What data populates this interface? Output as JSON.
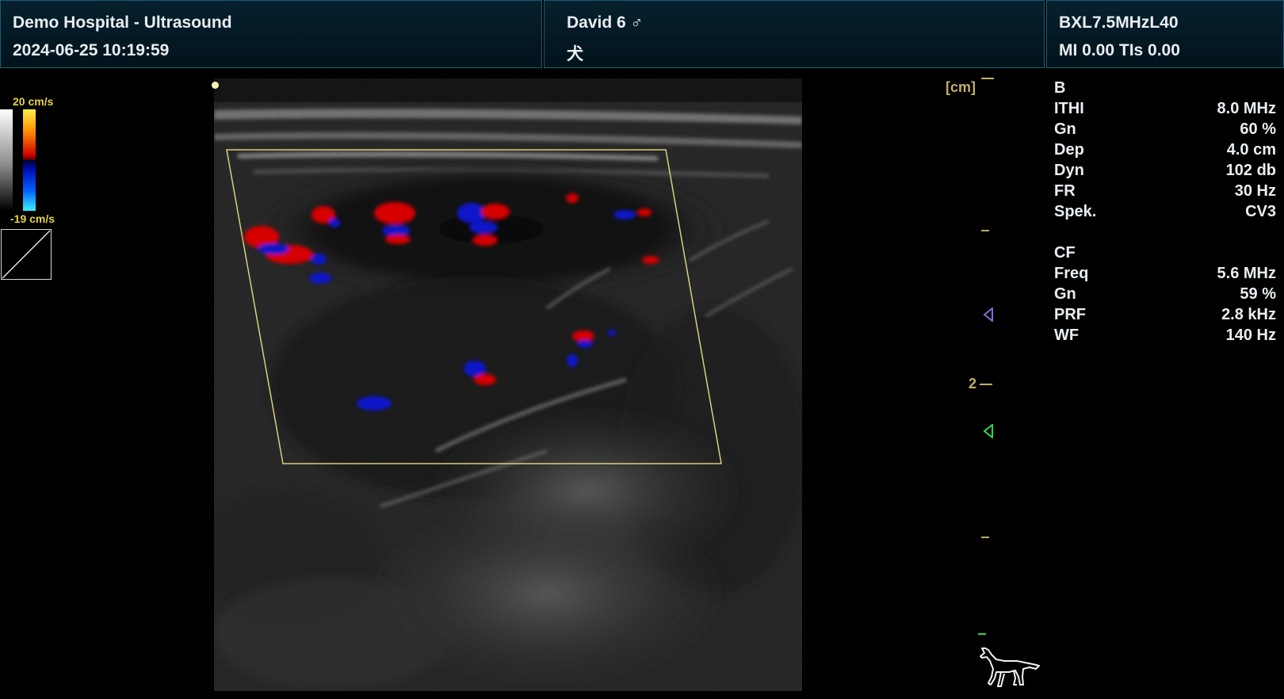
{
  "header": {
    "hospital": "Demo Hospital - Ultrasound",
    "datetime": "2024-06-25 10:19:59",
    "patient": "David 6 ♂",
    "species": "犬",
    "probe": "BXL7.5MHzL40",
    "indices": "MI 0.00 TIs 0.00"
  },
  "color_scale": {
    "max_label": "20 cm/s",
    "min_label": "-19 cm/s"
  },
  "depth_scale": {
    "unit_label": "[cm]",
    "tick_label": "2"
  },
  "b_mode": {
    "title": "B",
    "params": [
      {
        "name": "ITHI",
        "value": "8.0 MHz"
      },
      {
        "name": "Gn",
        "value": "60 %"
      },
      {
        "name": "Dep",
        "value": "4.0 cm"
      },
      {
        "name": "Dyn",
        "value": "102 db"
      },
      {
        "name": "FR",
        "value": "30 Hz"
      },
      {
        "name": "Spek.",
        "value": "CV3"
      }
    ]
  },
  "cf_mode": {
    "title": "CF",
    "params": [
      {
        "name": "Freq",
        "value": "5.6 MHz"
      },
      {
        "name": "Gn",
        "value": "59 %"
      },
      {
        "name": "PRF",
        "value": "2.8 kHz"
      },
      {
        "name": "WF",
        "value": "140 Hz"
      }
    ]
  },
  "colors": {
    "header_bg": "#041823",
    "header_border": "#1d5c72",
    "scale_text": "#bfb06a",
    "colorbar_label": "#e7d14e",
    "roi_box": "#d8d07a",
    "doppler_red": "#d60000",
    "doppler_blue": "#0a18c8",
    "focus_marker_purple": "#7a72d8",
    "focus_marker_green": "#2fd84a"
  },
  "icons": {
    "body_mark": "dog-icon",
    "focus_markers": [
      "triangle-left-icon",
      "triangle-left-icon"
    ]
  }
}
